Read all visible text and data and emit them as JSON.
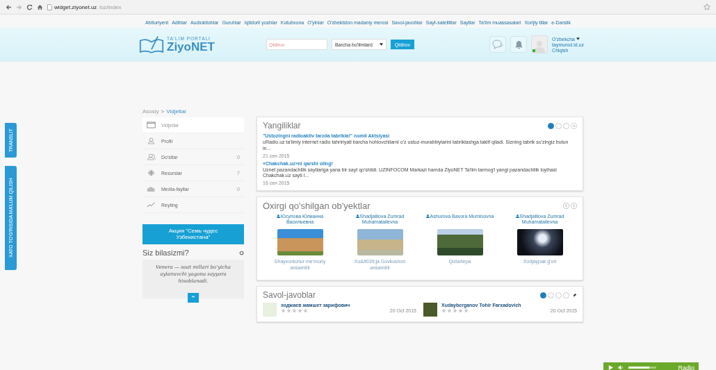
{
  "browser": {
    "url_domain": "widget.ziyonet.uz",
    "url_path": "/uz/index"
  },
  "top_links": [
    "Abituriyent",
    "Adiblar",
    "Audiokitoblar",
    "Guruhlar",
    "Iqtidorli yoshlar",
    "Kutubxona",
    "O'yinlar",
    "O'zbekiston madaniy merosi",
    "Savol-javoblar",
    "Sayt-satellitlar",
    "Saytlar",
    "Ta'lim muassasalari",
    "Xorijiy tillar",
    "e-Darslik"
  ],
  "header": {
    "logo_tagline": "TA'LIM PORTALI",
    "logo_name": "ZiyoNET",
    "search_placeholder": "Qidiruv",
    "section_select": "Barcha bo'limlard",
    "search_button": "Qidiruv",
    "user": {
      "language": "O'zbekcha",
      "username": "taymurod.id.uz",
      "logout": "Chiqish",
      "online": true
    }
  },
  "side_tabs": [
    "TRANSLIT",
    "XATO TO'G'RISIDA MA'LUM QILISH"
  ],
  "breadcrumb": [
    "Asosiy",
    "Vidjetlar"
  ],
  "breadcrumb_separator": ">",
  "menu": [
    {
      "label": "Vidjetlar",
      "selected": true
    },
    {
      "label": "Profil",
      "selected": false
    },
    {
      "label": "Do'stlar",
      "count": "0",
      "selected": false
    },
    {
      "label": "Resurslar",
      "count": "7",
      "selected": false
    },
    {
      "label": "Media-fayllar",
      "count": "0",
      "selected": false
    },
    {
      "label": "Reyting",
      "selected": false
    }
  ],
  "promo_button": "Акция \"Семь чудес Узбекистана\"",
  "fact": {
    "title": "Siz bilasizmi?",
    "text": "Venera — soat millari bo'yicha aylanuvchi yagona sayyora hisoblanadi.",
    "quote_button": "“"
  },
  "news": {
    "title": "Yangiliklar",
    "pages": [
      {
        "selected": true
      },
      {
        "selected": false
      },
      {
        "selected": false
      }
    ],
    "items": [
      {
        "title": "\"Ustozingni radioaktiv tarzda tabrikla!\" nomli Aktsiyasi",
        "text": "uRadio.uz ta'limiy internet radio tahririyati barcha hohlovchilarni o'z ustoz-murabbiylarini tabriklashga taklif qiladi. Sizning tabrik so'zingiz butun in...",
        "date": "21 сен 2015"
      },
      {
        "title": "«Chakchak.uz»ni qarshi oling!",
        "text": "Uznet pazandachilik saytlariga yana bir sayt qo'shildi. UZINFOCOM Markazi hamda ZiyoNET Ta'lim tarmog'i yangi pazandachilik loyihasi Chakchak.uz sayti i...",
        "date": "16 сен 2015"
      }
    ]
  },
  "objects": {
    "title": "Oxirgi qo'shilgan ob'yektlar",
    "items": [
      {
        "author": "Юсупова Юлианна Васильевна",
        "caption": "Shayxontohur me'moriy ansambli"
      },
      {
        "author": "Shadjalilova Zumrad Muhamatalievna",
        "caption": "Xo&#039;ja Govkushon ansambli"
      },
      {
        "author": "Ashurova Bavora Muminovna",
        "caption": "Qizlartepa"
      },
      {
        "author": "Shadjalilova Zumrad Muhamatalievna",
        "caption": "Xodjaypak g'ori"
      }
    ]
  },
  "qa": {
    "title": "Savol-javoblar",
    "pages": [
      {
        "selected": true
      },
      {
        "selected": false
      },
      {
        "selected": false
      },
      {
        "selected": false
      }
    ],
    "items": [
      {
        "name": "ходжаев жамшет зарифович",
        "stars": 0,
        "date": "20 Oct 2015"
      },
      {
        "name": "Xudayberganov Tohir Farxadovich",
        "stars": 0,
        "date": "20 Oct 2015"
      }
    ]
  },
  "radio": {
    "label": "Radio",
    "level": 0.75
  }
}
